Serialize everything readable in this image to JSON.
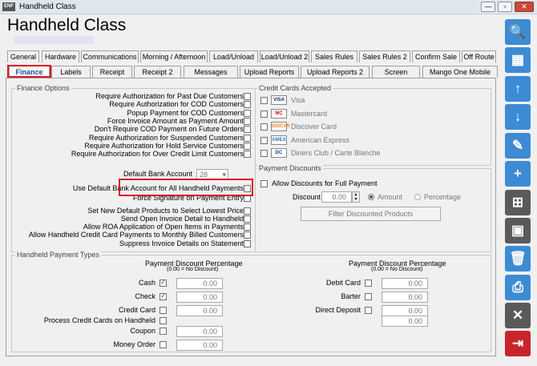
{
  "window": {
    "app_icon_text": "ENF",
    "title": "Handheld Class",
    "btn_min": "—",
    "btn_max": "▫",
    "btn_close": "✕"
  },
  "header": {
    "title": "Handheld Class"
  },
  "tabs_row1": [
    "General",
    "Hardware",
    "Communications",
    "Morning / Afternoon",
    "Load/Unload",
    "Load/Unload 2",
    "Sales Rules",
    "Sales Rules 2",
    "Confirm Sale",
    "Off Route"
  ],
  "tabs_row2": [
    "Finance",
    "Labels",
    "Receipt",
    "Receipt 2",
    "Messages",
    "Upload Reports",
    "Upload Reports 2",
    "Screen",
    "Mango One Mobile"
  ],
  "finance_options": {
    "label": "Finance Options",
    "items": [
      "Require Authorization for Past Due Customers",
      "Require Authorization for COD Customers",
      "Popup Payment for COD Customers",
      "Force Invoice Amount as Payment Amount",
      "Don't Require COD Payment on Future Orders",
      "Require Authorization for Suspended Customers",
      "Require Authorization for Hold Service Customers",
      "Require Authorization for Over Credit Limit Customers"
    ],
    "default_bank_label": "Default Bank Account",
    "default_bank_value": "28",
    "items2": [
      "Use Default Bank Account for All Handheld Payments",
      "Force Signature on Payment Entry",
      "Set New Default Products to Select Lowest Price",
      "Send Open Invoice Detail to Handheld",
      "Allow ROA Application of Open Items in Payments",
      "Allow Handheld Credit Card Payments to Monthly Billed Customers",
      "Suppress Invoice Details on Statement"
    ]
  },
  "credit_cards": {
    "label": "Credit Cards Accepted",
    "items": [
      {
        "name": "Visa",
        "icon": "visa-card-icon",
        "icon_text": "VISA",
        "color": "#1a1f71"
      },
      {
        "name": "Mastercard",
        "icon": "mastercard-icon",
        "icon_text": "MC",
        "color": "#eb001b"
      },
      {
        "name": "Discover Card",
        "icon": "discover-card-icon",
        "icon_text": "DISCVR",
        "color": "#f48120"
      },
      {
        "name": "American Express",
        "icon": "amex-card-icon",
        "icon_text": "AMEX",
        "color": "#2e77bc"
      },
      {
        "name": "Diners Club / Carte Blanche",
        "icon": "diners-club-icon",
        "icon_text": "DC",
        "color": "#004a97"
      }
    ]
  },
  "payment_discounts": {
    "label": "Payment Discounts",
    "allow_label": "Allow Discounts for Full Payment",
    "discount_label": "Discount",
    "discount_value": "0.00",
    "amount_label": "Amount",
    "percentage_label": "Percentage",
    "filter_button": "Filter Discounted Products"
  },
  "payment_types": {
    "label": "Handheld Payment Types",
    "header": "Payment Discount Percentage",
    "subheader": "(0.00 = No Discount)",
    "left": [
      {
        "label": "Cash",
        "checked": true,
        "value": "0.00"
      },
      {
        "label": "Check",
        "checked": true,
        "value": "0.00"
      },
      {
        "label": "Credit Card",
        "checked": false,
        "value": "0.00"
      },
      {
        "label": "Process Credit Cards on Handheld",
        "checked": false,
        "value": ""
      },
      {
        "label": "Coupon",
        "checked": false,
        "value": "0.00"
      },
      {
        "label": "Money Order",
        "checked": false,
        "value": "0.00"
      }
    ],
    "right": [
      {
        "label": "Debit Card",
        "checked": false,
        "value": "0.00"
      },
      {
        "label": "Barter",
        "checked": false,
        "value": "0.00"
      },
      {
        "label": "Direct Deposit",
        "checked": false,
        "value": "0.00"
      },
      {
        "label": "",
        "checked": false,
        "value": "0.00"
      }
    ]
  },
  "sidebar_icons": [
    "search-icon",
    "grid-view-icon",
    "arrow-up-icon",
    "arrow-down-icon",
    "edit-icon",
    "new-document-icon",
    "save-as-icon",
    "save-icon",
    "delete-icon",
    "print-icon",
    "cancel-icon",
    "exit-icon"
  ],
  "sidebar_glyphs": [
    "🔍",
    "▦",
    "↑",
    "↓",
    "✎",
    "+",
    "⊞",
    "▣",
    "🗑",
    "⎙",
    "✕",
    "⇥"
  ]
}
